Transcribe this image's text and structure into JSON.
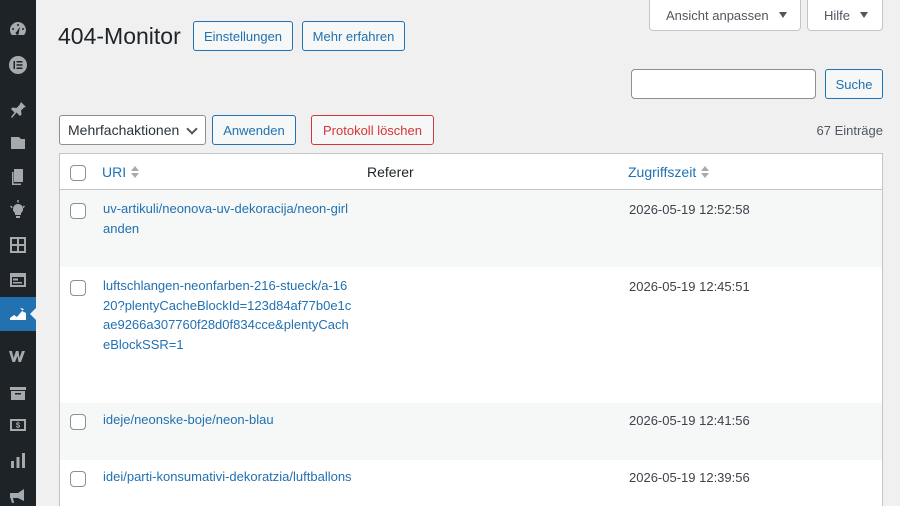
{
  "sidebar": {
    "items": [
      {
        "icon": "dashboard-icon",
        "current": false
      },
      {
        "icon": "elementor-icon",
        "current": false
      },
      {
        "icon": "pin-icon",
        "current": false
      },
      {
        "icon": "media-icon",
        "current": false
      },
      {
        "icon": "pages-icon",
        "current": false
      },
      {
        "icon": "lightbulb-icon",
        "current": false
      },
      {
        "icon": "grid-icon",
        "current": false
      },
      {
        "icon": "layout-icon",
        "current": false
      },
      {
        "icon": "redirect-tool-icon",
        "current": true
      },
      {
        "icon": "woocommerce-icon",
        "current": false
      },
      {
        "icon": "archive-icon",
        "current": false
      },
      {
        "icon": "money-icon",
        "current": false
      },
      {
        "icon": "analytics-icon",
        "current": false
      },
      {
        "icon": "megaphone-icon",
        "current": false
      }
    ]
  },
  "screen_meta": {
    "screen_options_label": "Ansicht anpassen",
    "help_label": "Hilfe"
  },
  "page": {
    "title": "404-Monitor",
    "settings_button": "Einstellungen",
    "learn_more_button": "Mehr erfahren"
  },
  "search": {
    "value": "",
    "button": "Suche"
  },
  "bulk": {
    "select_value": "Mehrfachaktionen",
    "apply_button": "Anwenden",
    "clear_log_button": "Protokoll löschen",
    "entry_count": "67 Einträge"
  },
  "table": {
    "columns": {
      "uri": "URI",
      "referer": "Referer",
      "access_time": "Zugriffszeit"
    },
    "rows": [
      {
        "uri": "uv-artikuli/neonova-uv-dekoracija/neon-girlanden",
        "referer": "",
        "time": "2026-05-19 12:52:58"
      },
      {
        "uri": "luftschlangen-neonfarben-216-stueck/a-1620?plentyCacheBlockId=123d84af77b0e1cae9266a307760f28d0f834cce&plentyCacheBlockSSR=1",
        "referer": "",
        "time": "2026-05-19 12:45:51"
      },
      {
        "uri": "ideje/neonske-boje/neon-blau",
        "referer": "",
        "time": "2026-05-19 12:41:56"
      },
      {
        "uri": "idei/parti-konsumativi-dekoratzia/luftballons",
        "referer": "",
        "time": "2026-05-19 12:39:56"
      }
    ]
  }
}
